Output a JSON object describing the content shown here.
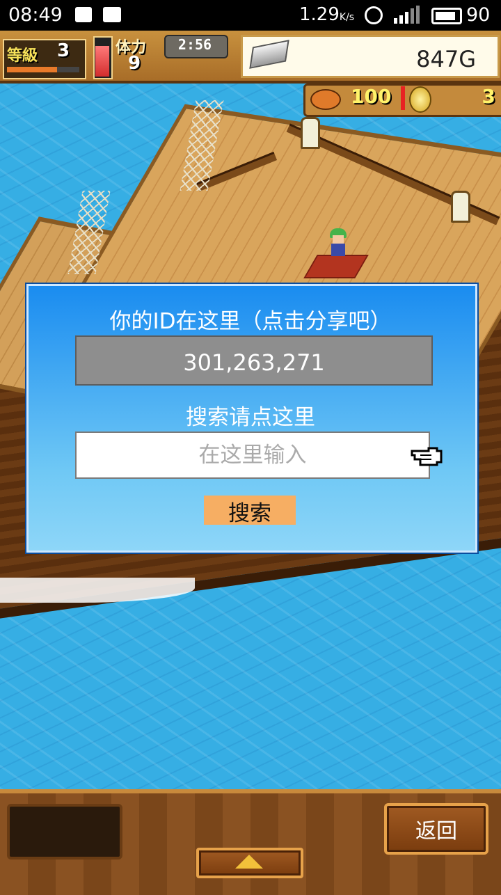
{
  "status_bar": {
    "time": "08:49",
    "net_speed": "1.29",
    "net_unit": "K/s",
    "battery": "90",
    "icons": [
      "notification-icon",
      "image-icon",
      "alarm-clock-icon",
      "4g-signal-icon",
      "battery-icon"
    ]
  },
  "hud": {
    "level_label": "等級",
    "level_value": "3",
    "stamina_label": "体力",
    "stamina_value": "9",
    "timer": "2:56",
    "gold": "847G",
    "food": "100",
    "coins": "3"
  },
  "dialog": {
    "id_title": "你的ID在这里（点击分享吧）",
    "id_value": "301,263,271",
    "search_title": "搜索请点这里",
    "search_placeholder": "在这里输入",
    "search_value": "",
    "search_button": "搜索"
  },
  "bottom": {
    "back_label": "返回"
  },
  "colors": {
    "sea": "#36aee4",
    "dialog_top": "#1a8cf0",
    "dialog_bottom": "#8ed6f8",
    "id_field": "#8e8e8e",
    "search_button": "#f6ae63",
    "wood": "#8a5222"
  }
}
